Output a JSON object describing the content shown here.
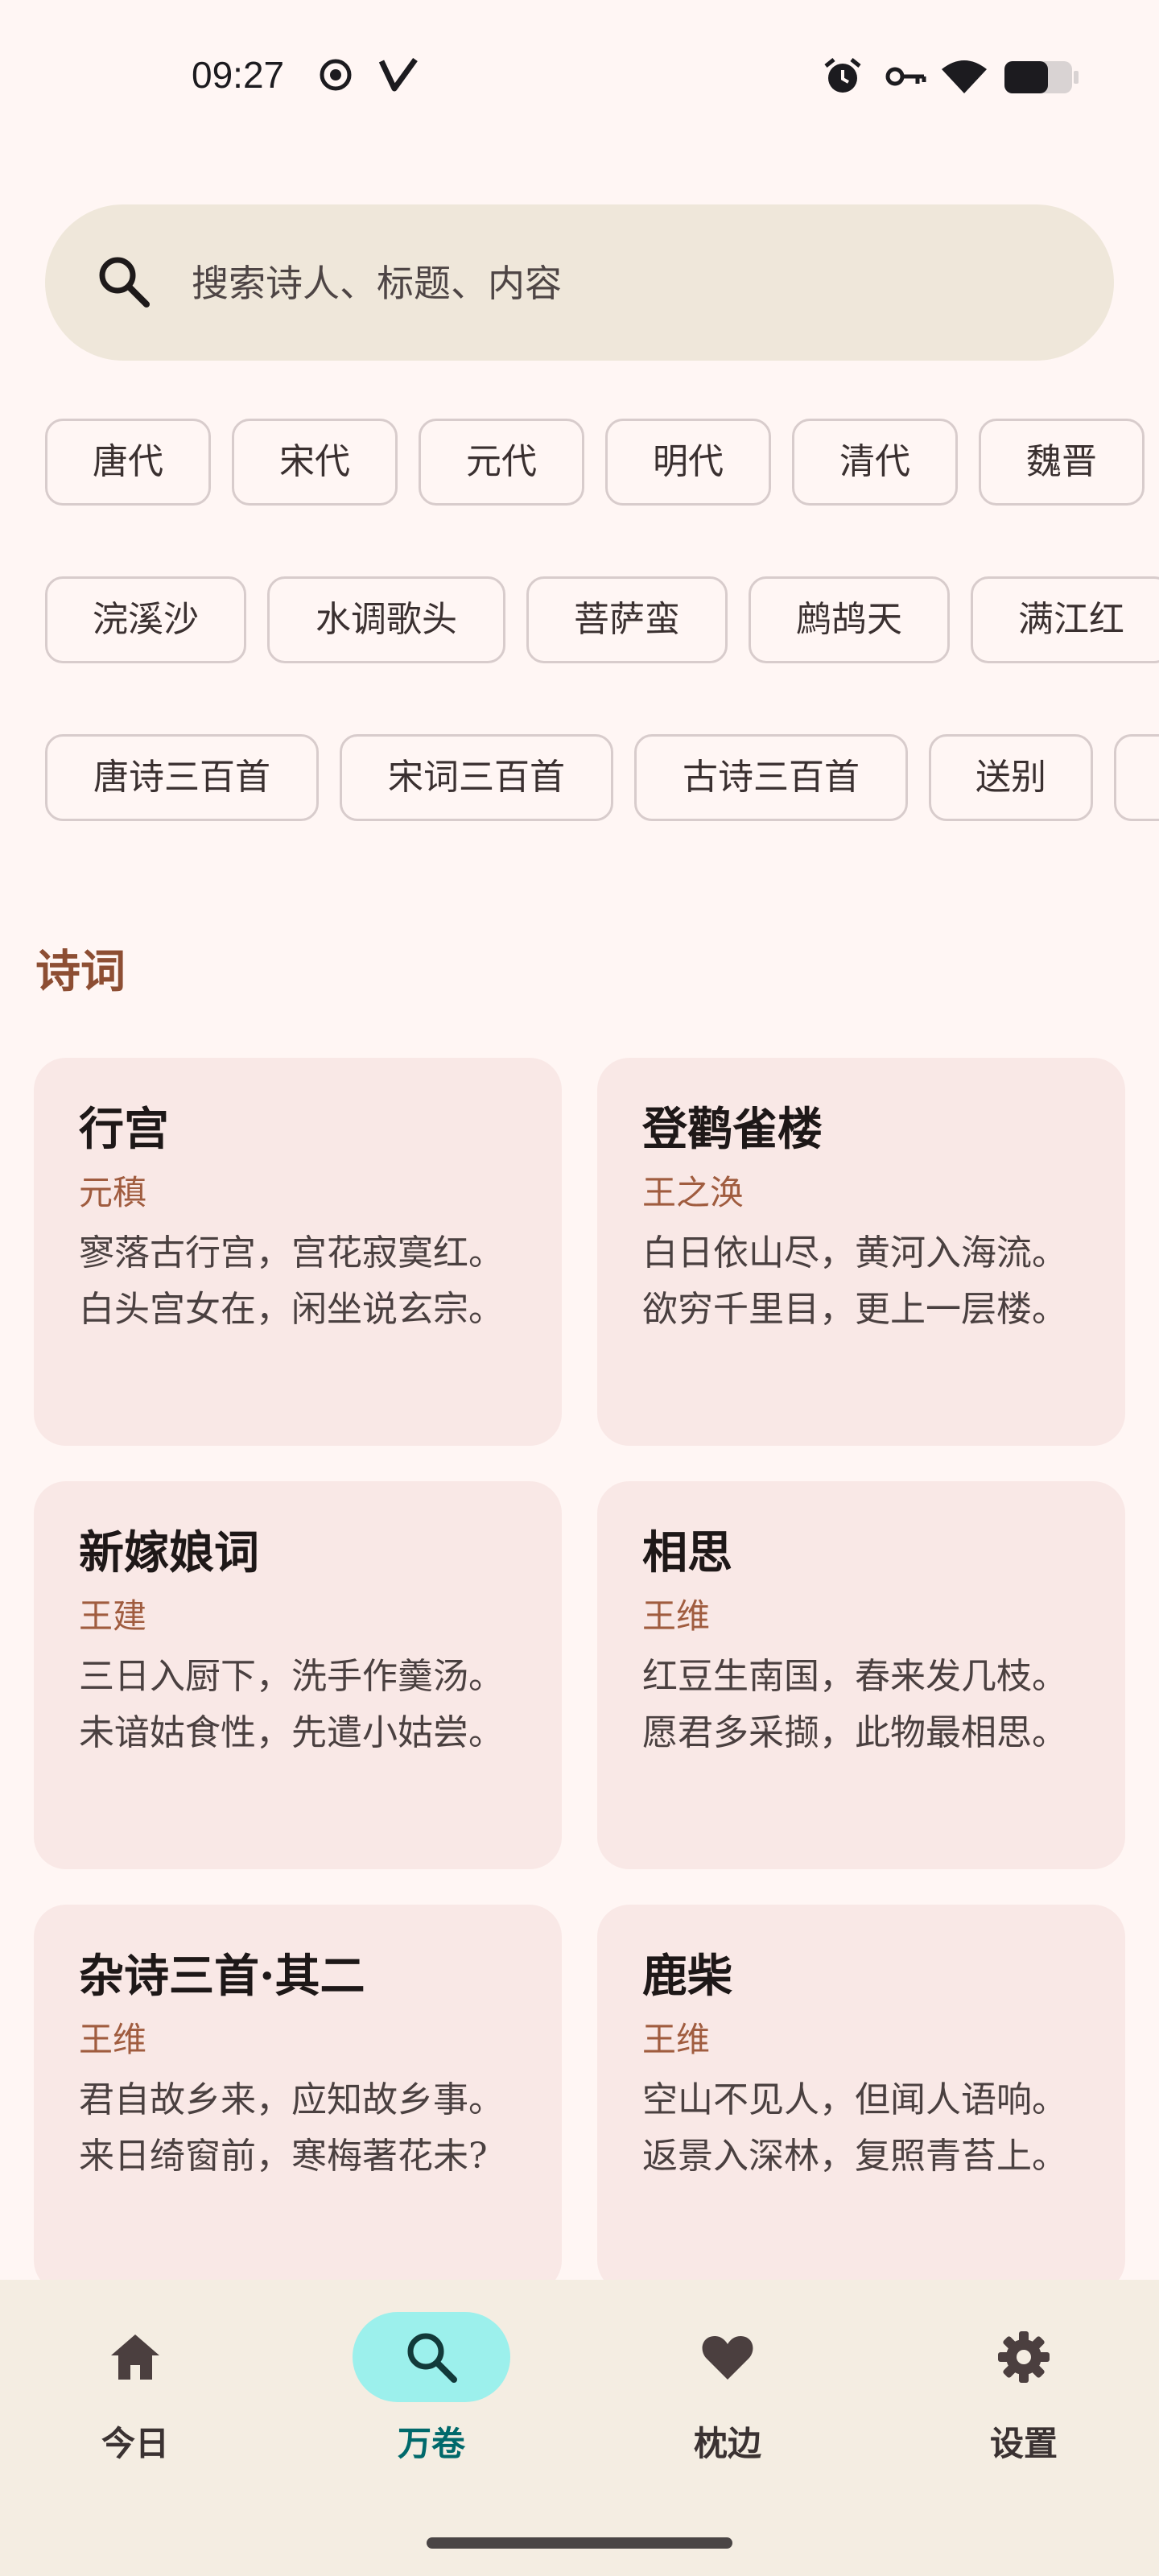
{
  "status_bar": {
    "time": "09:27",
    "icons": [
      "target-icon",
      "v-icon",
      "alarm-icon",
      "key-icon",
      "wifi-icon",
      "battery-icon"
    ]
  },
  "search": {
    "placeholder": "搜索诗人、标题、内容"
  },
  "chips": {
    "dynasties": [
      "唐代",
      "宋代",
      "元代",
      "明代",
      "清代",
      "魏晋"
    ],
    "tunes": [
      "浣溪沙",
      "水调歌头",
      "菩萨蛮",
      "鹧鸪天",
      "满江红"
    ],
    "collections": [
      "唐诗三百首",
      "宋词三百首",
      "古诗三百首",
      "送别",
      ""
    ]
  },
  "section_title": "诗词",
  "poems": [
    {
      "title": "行宫",
      "author": "元稹",
      "text": "寥落古行宫，宫花寂寞红。 白头宫女在，闲坐说玄宗。"
    },
    {
      "title": "登鹳雀楼",
      "author": "王之涣",
      "text": "白日依山尽，黄河入海流。 欲穷千里目，更上一层楼。"
    },
    {
      "title": "新嫁娘词",
      "author": "王建",
      "text": "三日入厨下，洗手作羹汤。 未谙姑食性，先遣小姑尝。"
    },
    {
      "title": "相思",
      "author": "王维",
      "text": "红豆生南国，春来发几枝。 愿君多采撷，此物最相思。"
    },
    {
      "title": "杂诗三首·其二",
      "author": "王维",
      "text": "君自故乡来，应知故乡事。 来日绮窗前，寒梅著花未?"
    },
    {
      "title": "鹿柴",
      "author": "王维",
      "text": "空山不见人，但闻人语响。 返景入深林，复照青苔上。"
    }
  ],
  "nav": [
    {
      "label": "今日",
      "icon": "home-icon",
      "active": false
    },
    {
      "label": "万卷",
      "icon": "search-icon",
      "active": true
    },
    {
      "label": "枕边",
      "icon": "heart-icon",
      "active": false
    },
    {
      "label": "设置",
      "icon": "gear-icon",
      "active": false
    }
  ],
  "colors": {
    "background": "#fff6f4",
    "card": "#f9e8e6",
    "accent_author": "#a05c3f",
    "section_title": "#8d4e33",
    "nav_active_pill": "#9cf0ec",
    "nav_active_label": "#00696b"
  }
}
